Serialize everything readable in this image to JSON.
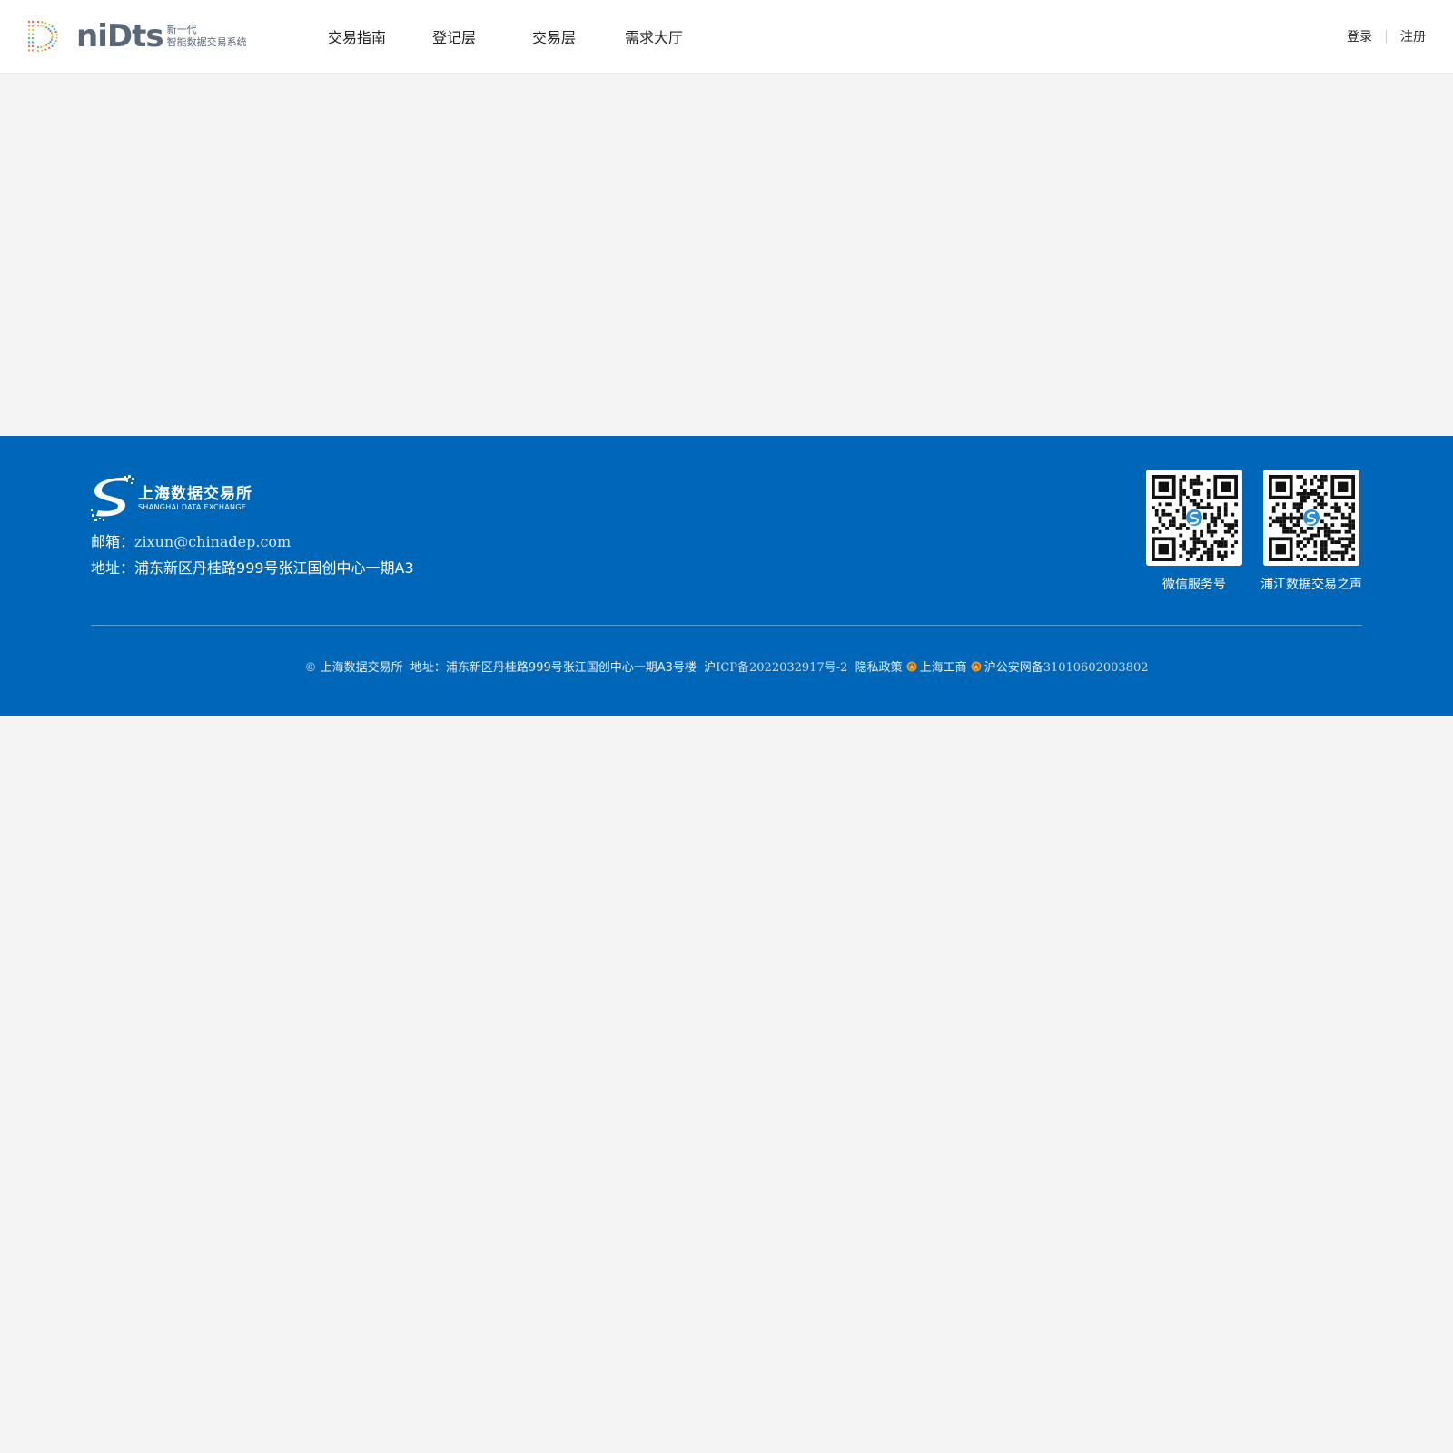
{
  "header": {
    "logo_word": "niDts",
    "logo_tag_line1": "新一代",
    "logo_tag_line2": "智能数据交易系统",
    "nav": [
      "交易指南",
      "登记层",
      "交易层",
      "需求大厅"
    ],
    "login": "登录",
    "register": "注册"
  },
  "footer": {
    "brand_cn": "上海数据交易所",
    "brand_en": "SHANGHAI DATA EXCHANGE",
    "email_label": "邮箱：",
    "email": "zixun@chinadep.com",
    "address_label": "地址：",
    "address": "浦东新区丹桂路999号张江国创中心一期A3",
    "qr1_caption": "微信服务号",
    "qr2_caption": "浦江数据交易之声",
    "copyright_symbol": "©",
    "copyright_org": "上海数据交易所",
    "bottom_address": "地址：浦东新区丹桂路999号张江国创中心一期A3号楼",
    "icp_prefix": "沪",
    "icp_number": "ICP备2022032917号-2",
    "privacy": "隐私政策",
    "gongshang": "上海工商",
    "gongan_prefix": "沪公安网备",
    "gongan_number": "31010602003802"
  },
  "colors": {
    "footer_bg": "#0066b8",
    "page_bg": "#f4f4f4"
  }
}
